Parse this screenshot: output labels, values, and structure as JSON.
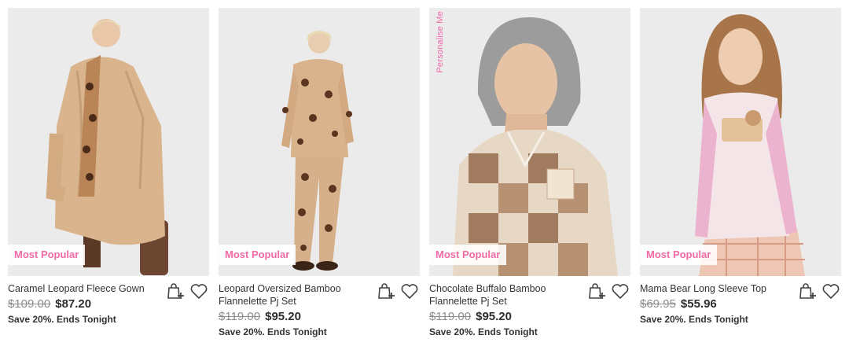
{
  "products": [
    {
      "title": "Caramel Leopard Fleece Gown",
      "was_price": "$109.00",
      "price": "$87.20",
      "promo": "Save 20%. Ends Tonight",
      "badge": "Most Popular",
      "image": "product-photo-caramel-leopard-fleece-gown"
    },
    {
      "title": "Leopard Oversized Bamboo Flannelette Pj Set",
      "was_price": "$119.00",
      "price": "$95.20",
      "promo": "Save 20%. Ends Tonight",
      "badge": "Most Popular",
      "image": "product-photo-leopard-pj-set"
    },
    {
      "title": "Chocolate Buffalo Bamboo Flannelette Pj Set",
      "was_price": "$119.00",
      "price": "$95.20",
      "promo": "Save 20%. Ends Tonight",
      "badge": "Most Popular",
      "personalise_label": "Personalise Me",
      "image": "product-photo-chocolate-buffalo-pj-set"
    },
    {
      "title": "Mama Bear Long Sleeve Top",
      "was_price": "$69.95",
      "price": "$55.96",
      "promo": "Save 20%. Ends Tonight",
      "badge": "Most Popular",
      "image": "product-photo-mama-bear-top"
    }
  ],
  "icons": {
    "add_to_bag": "bag-plus-icon",
    "wishlist": "heart-icon"
  },
  "colors": {
    "badge_text": "#f06aa6",
    "price_text": "#2d2d2d",
    "was_price_text": "#8d8d8d"
  }
}
